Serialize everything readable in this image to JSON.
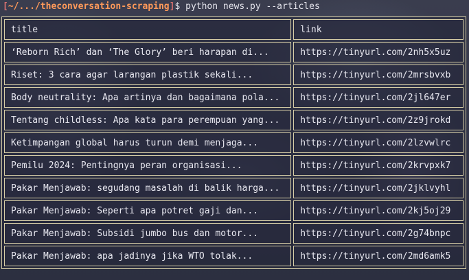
{
  "prompt": {
    "bracket_open": "[",
    "path_prefix": "~/.../",
    "path_dir": "theconversation-scraping",
    "bracket_close": "]",
    "dollar": "$",
    "command": "python news.py --articles"
  },
  "table": {
    "headers": {
      "title": "title",
      "link": "link"
    },
    "rows": [
      {
        "title": "‘Reborn Rich’ dan ‘The Glory’ beri harapan di...",
        "link": "https://tinyurl.com/2nh5x5uz"
      },
      {
        "title": "Riset: 3 cara agar larangan plastik sekali...",
        "link": "https://tinyurl.com/2mrsbvxb"
      },
      {
        "title": "Body neutrality: Apa artinya dan bagaimana pola...",
        "link": "https://tinyurl.com/2jl647er"
      },
      {
        "title": "Tentang childless: Apa kata para perempuan yang...",
        "link": "https://tinyurl.com/2z9jrokd"
      },
      {
        "title": "Ketimpangan global harus turun demi menjaga...",
        "link": "https://tinyurl.com/2lzvwlrc"
      },
      {
        "title": "Pemilu 2024: Pentingnya peran organisasi...",
        "link": "https://tinyurl.com/2krvpxk7"
      },
      {
        "title": "Pakar Menjawab: segudang masalah di balik harga...",
        "link": "https://tinyurl.com/2jklvyhl"
      },
      {
        "title": "Pakar Menjawab: Seperti apa potret gaji dan...",
        "link": "https://tinyurl.com/2kj5oj29"
      },
      {
        "title": "Pakar Menjawab: Subsidi jumbo bus dan motor...",
        "link": "https://tinyurl.com/2g74bnpc"
      },
      {
        "title": "Pakar Menjawab: apa jadinya jika WTO tolak...",
        "link": "https://tinyurl.com/2md6amk5"
      }
    ]
  }
}
